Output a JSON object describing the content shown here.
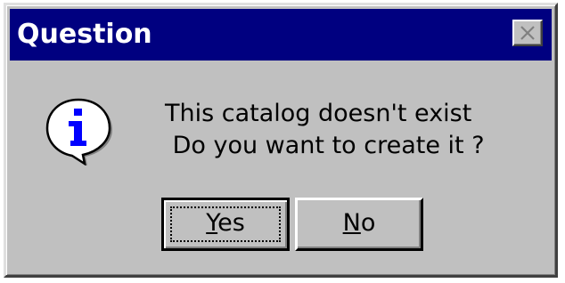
{
  "window": {
    "title": "Question"
  },
  "icons": {
    "dialog_icon": "information-icon",
    "close": "close-icon"
  },
  "message": {
    "line1": "This catalog doesn't exist",
    "line2": " Do you want to create it ?"
  },
  "buttons": {
    "yes": {
      "accelerator": "Y",
      "rest": "es",
      "focused": true
    },
    "no": {
      "accelerator": "N",
      "rest": "o",
      "focused": false
    }
  },
  "colors": {
    "titlebar": "#000080",
    "face": "#c0c0c0",
    "icon_glyph": "#0000ff"
  }
}
